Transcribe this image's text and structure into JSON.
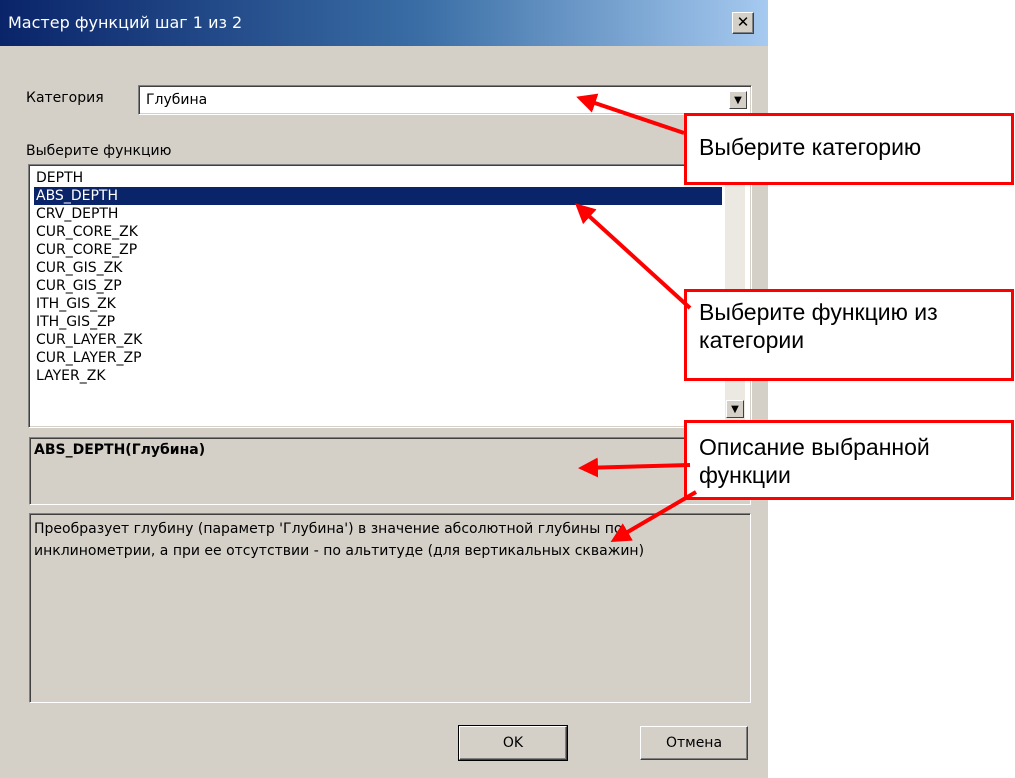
{
  "window": {
    "title": "Мастер функций шаг 1 из 2",
    "close_glyph": "✕"
  },
  "category": {
    "label": "Категория",
    "value": "Глубина"
  },
  "function_list": {
    "label": "Выберите функцию",
    "items": [
      "DEPTH",
      "ABS_DEPTH",
      "CRV_DEPTH",
      "CUR_CORE_ZK",
      "CUR_CORE_ZP",
      "CUR_GIS_ZK",
      "CUR_GIS_ZP",
      "ITH_GIS_ZK",
      "ITH_GIS_ZP",
      "CUR_LAYER_ZK",
      "CUR_LAYER_ZP",
      "LAYER_ZK"
    ],
    "selected_index": 1
  },
  "signature": "ABS_DEPTH(Глубина)",
  "description": "Преобразует глубину (параметр 'Глубина') в значение абсолютной глубины по инклинометрии, а при ее отсутствии - по альтитуде (для вертикальных скважин)",
  "buttons": {
    "ok": "OK",
    "cancel": "Отмена"
  },
  "callouts": {
    "category": "Выберите категорию",
    "function": "Выберите функцию из категории",
    "description": "Описание выбранной функции"
  },
  "colors": {
    "annotation": "#ff0000",
    "selection": "#0a246a",
    "dialog_bg": "#d4d0c8"
  }
}
